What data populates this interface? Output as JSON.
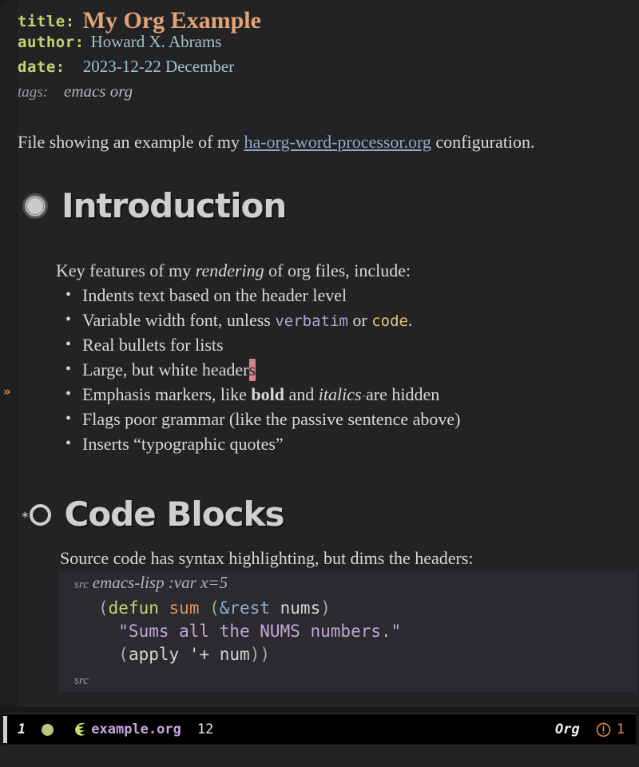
{
  "document": {
    "keywords": [
      {
        "key": "title:",
        "value": "My Org Example"
      },
      {
        "key": "author:",
        "value": "Howard X. Abrams"
      },
      {
        "key": "date:",
        "value": "2023-12-22 December"
      },
      {
        "key": "tags:",
        "value": "emacs org"
      }
    ],
    "intro_paragraph": {
      "before": "File showing an example of my ",
      "link": "ha-org-word-processor.org",
      "after": " configuration."
    },
    "sections": [
      {
        "heading": "Introduction",
        "bullet_glyph": "filled-ring-bullet",
        "lead": {
          "before": "Key features of my ",
          "italic": "rendering",
          "after": " of org files, include:"
        },
        "items": [
          {
            "text": "Indents text based on the header level"
          },
          {
            "prefix": "Variable width font, unless ",
            "verbatim": "verbatim",
            "middle": " or ",
            "code": "code",
            "suffix": "."
          },
          {
            "text": "Real bullets for lists"
          },
          {
            "prefix": "Large, but white header",
            "cursor_char": "s"
          },
          {
            "prefix": "Emphasis markers, like ",
            "bold": "bold",
            "middle": " and ",
            "italic": "italics",
            "suffix": " are hidden"
          },
          {
            "text": "Flags poor grammar (like the passive sentence above)"
          },
          {
            "text": "Inserts “typographic quotes”"
          }
        ]
      },
      {
        "heading": "Code Blocks",
        "bullet_glyph": "open-ring-bullet",
        "star_glyph": "*",
        "lead": "Source code has syntax highlighting, but dims the headers:",
        "src_block": {
          "begin_keyword": "src",
          "begin_args": "emacs-lisp :var x=5",
          "end_keyword": "src",
          "lines": [
            [
              {
                "t": "(",
                "c": "paren"
              },
              {
                "t": "defun",
                "c": "defun"
              },
              {
                "t": " ",
                "c": "paren"
              },
              {
                "t": "sum",
                "c": "fname"
              },
              {
                "t": " (",
                "c": "paren"
              },
              {
                "t": "&rest",
                "c": "amp"
              },
              {
                "t": " ",
                "c": "paren"
              },
              {
                "t": "nums",
                "c": "var"
              },
              {
                "t": ")",
                "c": "paren"
              }
            ],
            [
              {
                "t": "  \"Sums all the NUMS numbers.\"",
                "c": "string"
              }
            ],
            [
              {
                "t": "  (",
                "c": "paren"
              },
              {
                "t": "apply",
                "c": "var"
              },
              {
                "t": " ",
                "c": "paren"
              },
              {
                "t": "'+",
                "c": "var"
              },
              {
                "t": " ",
                "c": "paren"
              },
              {
                "t": "num",
                "c": "var"
              },
              {
                "t": "))",
                "c": "paren"
              }
            ]
          ]
        }
      }
    ],
    "fringe_marker": "»"
  },
  "modeline": {
    "line_number": "1",
    "status_dot": "modified-indicator",
    "app_icon": "emacs-gnu-icon",
    "buffer_name": "example.org",
    "column": "12",
    "major_mode": "Org",
    "warning_icon": "exclamation-circle-icon",
    "warning_count": "1"
  },
  "colors": {
    "background": "#232326",
    "fringe": "#1e1e21",
    "code_block_bg": "#2b2b2f",
    "modeline_bg": "#000000",
    "title": "#e2a375",
    "keyword": "#c5d46e",
    "meta_value": "#9fc3bd",
    "body_text": "#d8d8d6",
    "link": "#8fa9c6",
    "heading": "#cfcfcd",
    "verbatim": "#aba6d8",
    "inline_code": "#e2c275",
    "cursor": "#d4848c",
    "string": "#c3a6d8",
    "function_name": "#e0925f",
    "buffer_name": "#c5a8dd",
    "warning": "#e09050"
  }
}
